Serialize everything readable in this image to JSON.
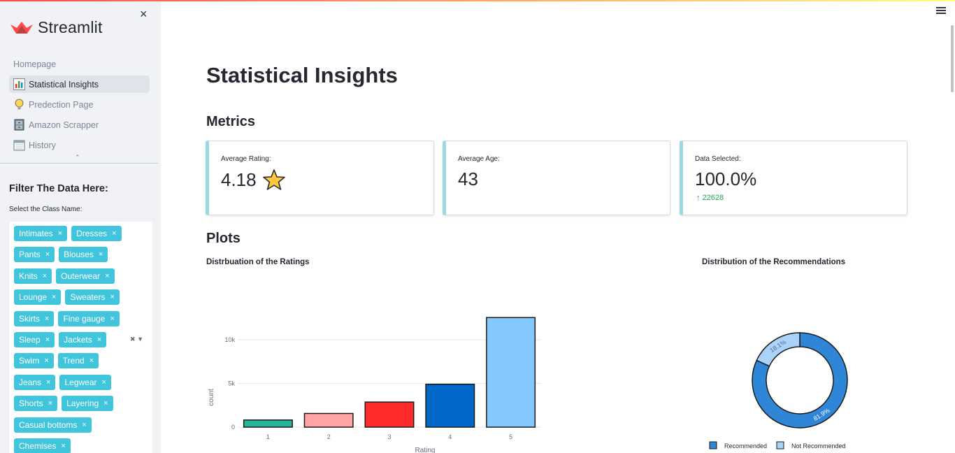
{
  "app": {
    "brand": "Streamlit",
    "close_label": "×"
  },
  "sidebar": {
    "nav": [
      {
        "label": "Homepage",
        "icon": "none",
        "active": false
      },
      {
        "label": "Statistical Insights",
        "icon": "bar-chart-icon",
        "active": true
      },
      {
        "label": "Predection Page",
        "icon": "lightbulb-icon",
        "active": false
      },
      {
        "label": "Amazon Scrapper",
        "icon": "cabinet-icon",
        "active": false
      },
      {
        "label": "History",
        "icon": "calendar-icon",
        "active": false
      }
    ],
    "filter_title": "Filter The Data Here:",
    "select_label": "Select the Class Name:",
    "selected_classes": [
      [
        "Intimates",
        "Dresses"
      ],
      [
        "Pants",
        "Blouses"
      ],
      [
        "Knits",
        "Outerwear"
      ],
      [
        "Lounge",
        "Sweaters"
      ],
      [
        "Skirts",
        "Fine gauge"
      ],
      [
        "Sleep",
        "Jackets"
      ],
      [
        "Swim",
        "Trend"
      ],
      [
        "Jeans",
        "Legwear"
      ],
      [
        "Shorts",
        "Layering"
      ],
      [
        "Casual bottoms"
      ],
      [
        "Chemises"
      ]
    ],
    "chip_remove": "×"
  },
  "main": {
    "title": "Statistical Insights",
    "metrics_header": "Metrics",
    "metrics": [
      {
        "label": "Average Rating:",
        "value": "4.18",
        "icon": "star-icon"
      },
      {
        "label": "Average Age:",
        "value": "43"
      },
      {
        "label": "Data Selected:",
        "value": "100.0%",
        "delta": "22628",
        "delta_icon": "arrow-up-icon"
      }
    ],
    "plots_header": "Plots",
    "colors": {
      "accent": "#40c5dd",
      "metric_border": "#9bd8e2",
      "delta": "#21a552"
    }
  },
  "chart_data": [
    {
      "type": "bar",
      "title": "Distrbuation of the Ratings",
      "xlabel": "Rating",
      "ylabel": "count",
      "categories": [
        "1",
        "2",
        "3",
        "4",
        "5"
      ],
      "values": [
        815,
        1565,
        2871,
        4908,
        12540
      ],
      "colors": [
        "#2ab49a",
        "#ffa3a3",
        "#ff2b2b",
        "#0068c9",
        "#83c9ff"
      ],
      "y_ticks": [
        {
          "value": 0,
          "label": "0"
        },
        {
          "value": 5000,
          "label": "5k"
        },
        {
          "value": 10000,
          "label": "10k"
        }
      ],
      "ylim": [
        0,
        13200
      ],
      "grid": true
    },
    {
      "type": "pie",
      "title": "Distribution of the Recommendations",
      "labels": [
        "Recommended",
        "Not Recommended"
      ],
      "values": [
        81.9,
        18.1
      ],
      "slice_labels": [
        "81.9%",
        "18.1%"
      ],
      "colors": [
        "#2f86d6",
        "#a9d3fb"
      ],
      "hole": true,
      "legend": "bottom"
    }
  ]
}
